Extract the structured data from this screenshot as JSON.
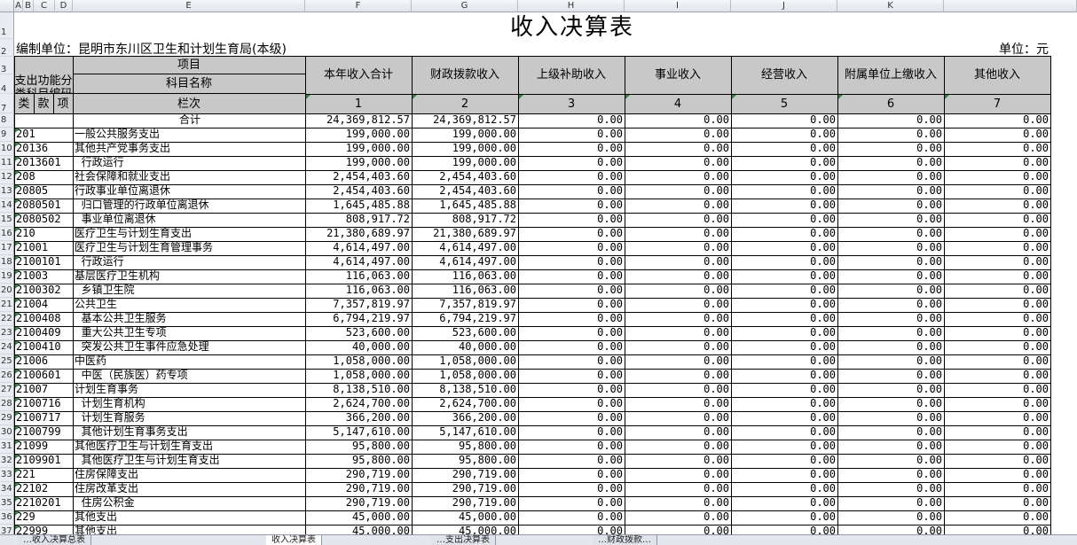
{
  "column_headers": [
    "A",
    "B",
    "C",
    "D",
    "E",
    "F",
    "G",
    "H",
    "I",
    "J",
    "K"
  ],
  "title": "收入决算表",
  "org_label": "编制单位：昆明市东川区卫生和计划生育局(本级)",
  "unit_label": "单位：元",
  "header": {
    "item": "项目",
    "func_code": "支出功能分类科目编码",
    "subject_name": "科目名称",
    "lanci": "栏次",
    "lei": "类",
    "kuan": "款",
    "xiang": "项",
    "total_label": "合计",
    "columns": [
      "本年收入合计",
      "财政拨款收入",
      "上级补助收入",
      "事业收入",
      "经营收入",
      "附属单位上缴收入",
      "其他收入"
    ],
    "col_numbers": [
      "1",
      "2",
      "3",
      "4",
      "5",
      "6",
      "7"
    ]
  },
  "row_numbers": [
    "1",
    "2",
    "3",
    "4",
    "7",
    "8",
    "9",
    "10",
    "11",
    "12",
    "13",
    "14",
    "15",
    "16",
    "17",
    "18",
    "19",
    "20",
    "21",
    "22",
    "23",
    "24",
    "25",
    "26",
    "27",
    "28",
    "29",
    "30",
    "31",
    "32",
    "33",
    "34",
    "35",
    "36",
    "37"
  ],
  "total_row": [
    "24,369,812.57",
    "24,369,812.57",
    "0.00",
    "0.00",
    "0.00",
    "0.00",
    "0.00"
  ],
  "rows": [
    {
      "code": "201",
      "name": "一般公共服务支出",
      "vals": [
        "199,000.00",
        "199,000.00",
        "0.00",
        "0.00",
        "0.00",
        "0.00",
        "0.00"
      ]
    },
    {
      "code": "20136",
      "name": "其他共产党事务支出",
      "vals": [
        "199,000.00",
        "199,000.00",
        "0.00",
        "0.00",
        "0.00",
        "0.00",
        "0.00"
      ]
    },
    {
      "code": "2013601",
      "name": "  行政运行",
      "vals": [
        "199,000.00",
        "199,000.00",
        "0.00",
        "0.00",
        "0.00",
        "0.00",
        "0.00"
      ]
    },
    {
      "code": "208",
      "name": "社会保障和就业支出",
      "vals": [
        "2,454,403.60",
        "2,454,403.60",
        "0.00",
        "0.00",
        "0.00",
        "0.00",
        "0.00"
      ]
    },
    {
      "code": "20805",
      "name": "行政事业单位离退休",
      "vals": [
        "2,454,403.60",
        "2,454,403.60",
        "0.00",
        "0.00",
        "0.00",
        "0.00",
        "0.00"
      ]
    },
    {
      "code": "2080501",
      "name": "  归口管理的行政单位离退休",
      "vals": [
        "1,645,485.88",
        "1,645,485.88",
        "0.00",
        "0.00",
        "0.00",
        "0.00",
        "0.00"
      ]
    },
    {
      "code": "2080502",
      "name": "  事业单位离退休",
      "vals": [
        "808,917.72",
        "808,917.72",
        "0.00",
        "0.00",
        "0.00",
        "0.00",
        "0.00"
      ]
    },
    {
      "code": "210",
      "name": "医疗卫生与计划生育支出",
      "vals": [
        "21,380,689.97",
        "21,380,689.97",
        "0.00",
        "0.00",
        "0.00",
        "0.00",
        "0.00"
      ]
    },
    {
      "code": "21001",
      "name": "医疗卫生与计划生育管理事务",
      "vals": [
        "4,614,497.00",
        "4,614,497.00",
        "0.00",
        "0.00",
        "0.00",
        "0.00",
        "0.00"
      ]
    },
    {
      "code": "2100101",
      "name": "  行政运行",
      "vals": [
        "4,614,497.00",
        "4,614,497.00",
        "0.00",
        "0.00",
        "0.00",
        "0.00",
        "0.00"
      ]
    },
    {
      "code": "21003",
      "name": "基层医疗卫生机构",
      "vals": [
        "116,063.00",
        "116,063.00",
        "0.00",
        "0.00",
        "0.00",
        "0.00",
        "0.00"
      ]
    },
    {
      "code": "2100302",
      "name": "  乡镇卫生院",
      "vals": [
        "116,063.00",
        "116,063.00",
        "0.00",
        "0.00",
        "0.00",
        "0.00",
        "0.00"
      ]
    },
    {
      "code": "21004",
      "name": "公共卫生",
      "vals": [
        "7,357,819.97",
        "7,357,819.97",
        "0.00",
        "0.00",
        "0.00",
        "0.00",
        "0.00"
      ]
    },
    {
      "code": "2100408",
      "name": "  基本公共卫生服务",
      "vals": [
        "6,794,219.97",
        "6,794,219.97",
        "0.00",
        "0.00",
        "0.00",
        "0.00",
        "0.00"
      ]
    },
    {
      "code": "2100409",
      "name": "  重大公共卫生专项",
      "vals": [
        "523,600.00",
        "523,600.00",
        "0.00",
        "0.00",
        "0.00",
        "0.00",
        "0.00"
      ]
    },
    {
      "code": "2100410",
      "name": "  突发公共卫生事件应急处理",
      "vals": [
        "40,000.00",
        "40,000.00",
        "0.00",
        "0.00",
        "0.00",
        "0.00",
        "0.00"
      ]
    },
    {
      "code": "21006",
      "name": "中医药",
      "vals": [
        "1,058,000.00",
        "1,058,000.00",
        "0.00",
        "0.00",
        "0.00",
        "0.00",
        "0.00"
      ]
    },
    {
      "code": "2100601",
      "name": "  中医（民族医）药专项",
      "vals": [
        "1,058,000.00",
        "1,058,000.00",
        "0.00",
        "0.00",
        "0.00",
        "0.00",
        "0.00"
      ]
    },
    {
      "code": "21007",
      "name": "计划生育事务",
      "vals": [
        "8,138,510.00",
        "8,138,510.00",
        "0.00",
        "0.00",
        "0.00",
        "0.00",
        "0.00"
      ]
    },
    {
      "code": "2100716",
      "name": "  计划生育机构",
      "vals": [
        "2,624,700.00",
        "2,624,700.00",
        "0.00",
        "0.00",
        "0.00",
        "0.00",
        "0.00"
      ]
    },
    {
      "code": "2100717",
      "name": "  计划生育服务",
      "vals": [
        "366,200.00",
        "366,200.00",
        "0.00",
        "0.00",
        "0.00",
        "0.00",
        "0.00"
      ]
    },
    {
      "code": "2100799",
      "name": "  其他计划生育事务支出",
      "vals": [
        "5,147,610.00",
        "5,147,610.00",
        "0.00",
        "0.00",
        "0.00",
        "0.00",
        "0.00"
      ]
    },
    {
      "code": "21099",
      "name": "其他医疗卫生与计划生育支出",
      "vals": [
        "95,800.00",
        "95,800.00",
        "0.00",
        "0.00",
        "0.00",
        "0.00",
        "0.00"
      ]
    },
    {
      "code": "2109901",
      "name": "  其他医疗卫生与计划生育支出",
      "vals": [
        "95,800.00",
        "95,800.00",
        "0.00",
        "0.00",
        "0.00",
        "0.00",
        "0.00"
      ]
    },
    {
      "code": "221",
      "name": "住房保障支出",
      "vals": [
        "290,719.00",
        "290,719.00",
        "0.00",
        "0.00",
        "0.00",
        "0.00",
        "0.00"
      ]
    },
    {
      "code": "22102",
      "name": "住房改革支出",
      "vals": [
        "290,719.00",
        "290,719.00",
        "0.00",
        "0.00",
        "0.00",
        "0.00",
        "0.00"
      ]
    },
    {
      "code": "2210201",
      "name": "  住房公积金",
      "vals": [
        "290,719.00",
        "290,719.00",
        "0.00",
        "0.00",
        "0.00",
        "0.00",
        "0.00"
      ]
    },
    {
      "code": "229",
      "name": "其他支出",
      "vals": [
        "45,000.00",
        "45,000.00",
        "0.00",
        "0.00",
        "0.00",
        "0.00",
        "0.00"
      ]
    },
    {
      "code": "22999",
      "name": "其他支出",
      "vals": [
        "45,000.00",
        "45,000.00",
        "0.00",
        "0.00",
        "0.00",
        "0.00",
        "0.00"
      ]
    }
  ],
  "sheet_tabs": [
    "…收入决算总表",
    "收入决算表",
    "…支出决算表",
    "…财政拨款…"
  ],
  "colors": {
    "header_fill": "#c8c8c8",
    "col_header_bg": "#dfe3e8",
    "grid": "#000000",
    "marker": "#1f8f3a"
  }
}
